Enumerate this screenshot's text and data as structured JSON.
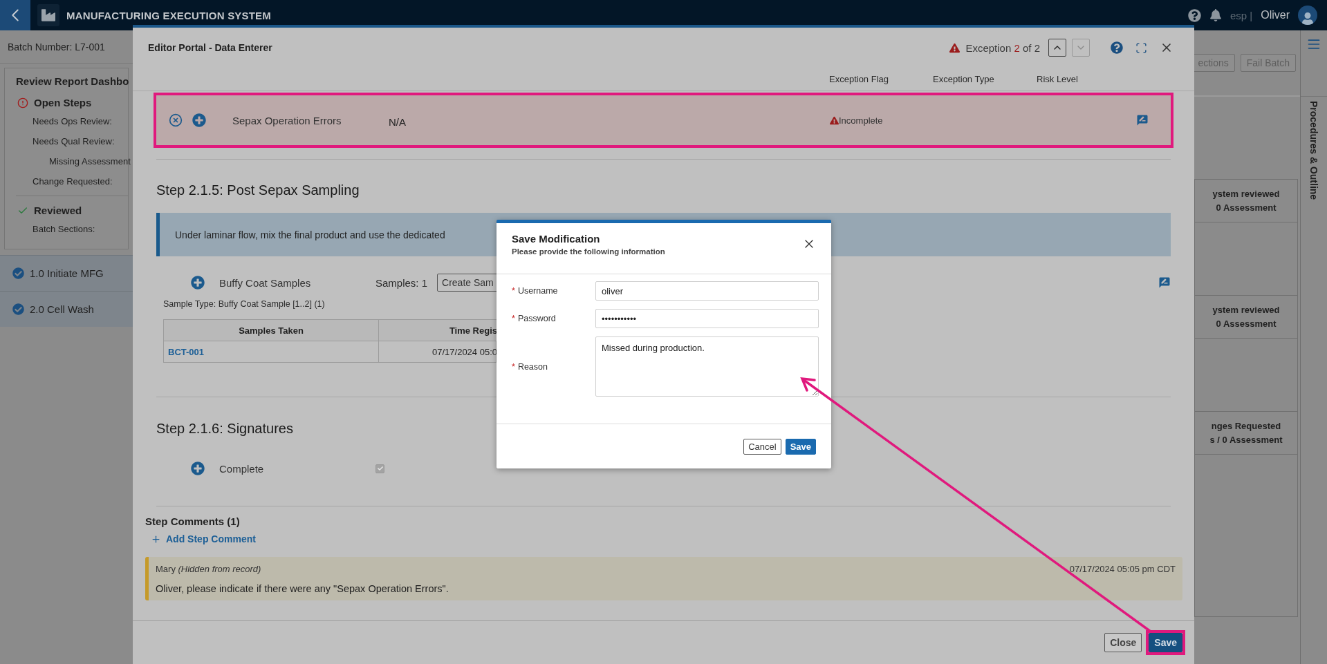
{
  "top_bar": {
    "title": "MANUFACTURING EXECUTION SYSTEM",
    "site": "esp |",
    "user": "Oliver"
  },
  "page": {
    "batch_number": "Batch Number: L7-001",
    "dashboard": {
      "title": "Review Report Dashbo",
      "groups": [
        {
          "kind": "open",
          "label": "Open Steps",
          "items": [
            {
              "label": "Needs Ops Review:"
            },
            {
              "label": "Needs Qual Review:",
              "children": [
                {
                  "label": "Missing Assessment"
                }
              ]
            },
            {
              "label": "Change Requested:"
            }
          ]
        },
        {
          "kind": "reviewed",
          "label": "Reviewed",
          "items": [
            {
              "label": "Batch Sections:"
            }
          ]
        }
      ]
    },
    "sections": [
      {
        "label": "1.0 Initiate MFG",
        "complete": true
      },
      {
        "label": "2.0 Cell Wash",
        "complete": true
      }
    ],
    "actions": [
      "ections",
      "Fail Batch"
    ],
    "summary_cards": [
      {
        "lines": [
          "ystem reviewed",
          "0 Assessment"
        ]
      },
      {
        "lines": [
          "ystem reviewed",
          "0 Assessment"
        ]
      },
      {
        "lines": [
          "nges Requested",
          "s / 0 Assessment"
        ]
      }
    ],
    "sidebar_label": "Procedures & Outline"
  },
  "editor": {
    "title": "Editor Portal - Data Enterer",
    "exception": {
      "prefix": "Exception",
      "current": "2",
      "suffix": "of 2"
    },
    "nav": [
      {
        "kind": "up",
        "disabled": false
      },
      {
        "kind": "down",
        "disabled": true
      }
    ],
    "columns": [
      "Exception Flag",
      "Exception Type",
      "Risk Level"
    ],
    "exception_row": {
      "name": "Sepax Operation Errors",
      "value": "N/A",
      "flag": "Incomplete"
    },
    "steps": [
      {
        "title": "Step 2.1.5: Post Sepax Sampling",
        "instruction": "Under laminar flow, mix the final product and use the dedicated",
        "fields": [
          {
            "kind": "samples",
            "label": "Buffy Coat Samples",
            "count": "Samples: 1",
            "button": "Create Sam",
            "sample_type": "Sample Type: Buffy Coat Sample [1..2] (1)",
            "columns": [
              "Samples Taken",
              "Time Regis"
            ],
            "rows": [
              [
                "BCT-001",
                "07/17/2024 05:0"
              ]
            ]
          }
        ]
      },
      {
        "title": "Step 2.1.6: Signatures",
        "fields": [
          {
            "kind": "checkbox",
            "label": "Complete",
            "checked": true
          }
        ]
      }
    ],
    "comments": {
      "title": "Step Comments (1)",
      "add_label": "Add Step Comment",
      "items": [
        {
          "author": "Mary *(Hidden from record)*",
          "text": "Oliver, please indicate if there were any \"Sepax Operation Errors\".",
          "time": "07/17/2024 05:05 pm CDT"
        }
      ]
    },
    "footer": [
      {
        "label": "Close",
        "primary": false
      },
      {
        "label": "Save",
        "primary": true
      }
    ]
  },
  "dialog": {
    "title": "Save Modification",
    "subtitle": "Please provide the following information",
    "fields": [
      {
        "kind": "text",
        "mark": "*",
        "label": "Username",
        "value": "oliver"
      },
      {
        "kind": "text",
        "mark": "*",
        "label": "Password",
        "value": "•••••••••••"
      },
      {
        "kind": "textarea",
        "mark": "*",
        "label": "Reason",
        "value": "Missed during production."
      }
    ],
    "buttons": [
      {
        "label": "Cancel",
        "primary": false
      },
      {
        "label": "Save",
        "primary": true
      }
    ]
  }
}
